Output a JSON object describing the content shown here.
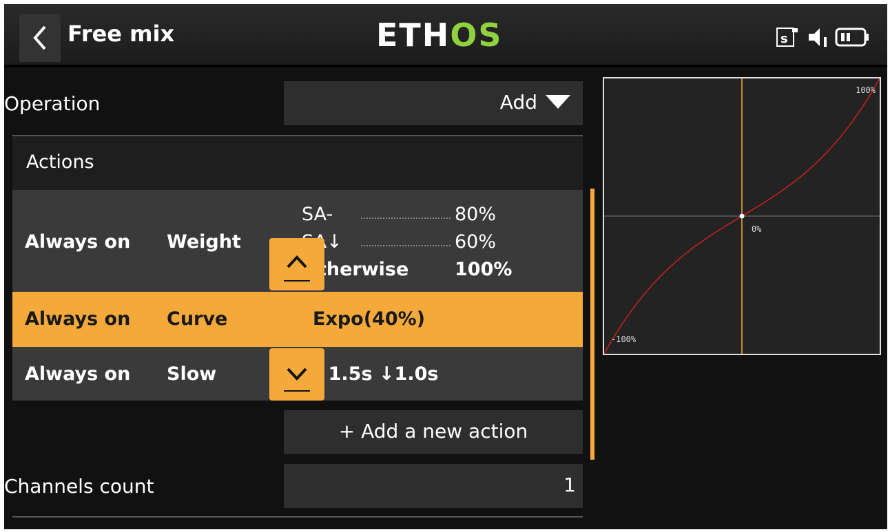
{
  "header": {
    "title": "Free mix",
    "logo_part1": "ETH",
    "logo_part2": "OS",
    "icons": [
      "back-chevron-icon",
      "sd-card-icon",
      "speaker-icon",
      "battery-icon"
    ]
  },
  "operation": {
    "label": "Operation",
    "value": "Add"
  },
  "actions": {
    "section_label": "Actions",
    "rows": [
      {
        "condition": "Always on",
        "type": "Weight",
        "values": [
          {
            "name": "SA-",
            "value": "80%"
          },
          {
            "name": "SA↓",
            "value": "60%"
          },
          {
            "name": "Otherwise",
            "value": "100%"
          }
        ]
      },
      {
        "condition": "Always on",
        "type": "Curve",
        "value": "Expo(40%)",
        "selected": true
      },
      {
        "condition": "Always on",
        "type": "Slow",
        "value": "↑1.5s ↓1.0s"
      }
    ],
    "add_label": "+ Add a new action"
  },
  "channels_count": {
    "label": "Channels count",
    "value": "1"
  },
  "graph": {
    "label_top": "100%",
    "label_center": "0%",
    "label_bottom": "-100%",
    "curve_color": "#cc1f1f",
    "axis_color": "#f5a93a"
  },
  "colors": {
    "accent": "#f5a93a",
    "logo_green": "#8fd13f"
  }
}
